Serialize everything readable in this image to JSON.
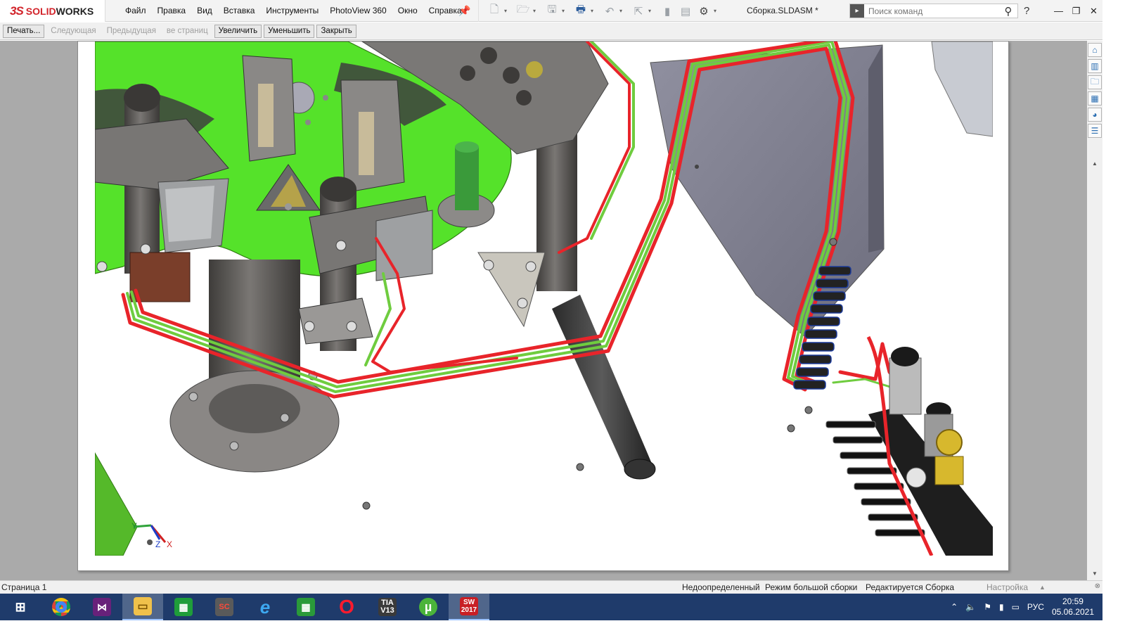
{
  "app": {
    "brand_ds": "3S",
    "brand_name_1": "SOLID",
    "brand_name_2": "WORKS",
    "document_title": "Сборка.SLDASM *"
  },
  "menu": {
    "items": [
      "Файл",
      "Правка",
      "Вид",
      "Вставка",
      "Инструменты",
      "PhotoView 360",
      "Окно",
      "Справка"
    ]
  },
  "quick_access_icons": [
    "new-icon",
    "open-icon",
    "save-icon",
    "print-icon",
    "undo-icon",
    "select-icon",
    "rebuild-icon",
    "file-properties-icon",
    "options-icon"
  ],
  "search": {
    "placeholder": "Поиск команд"
  },
  "window_controls": {
    "help": "?",
    "minimize": "—",
    "restore": "❐",
    "close": "✕"
  },
  "preview_toolbar": {
    "print": "Печать...",
    "next": "Следующая",
    "previous": "Предыдущая",
    "all_pages": "ве страниц",
    "zoom_in": "Увеличить",
    "zoom_out": "Уменьшить",
    "close": "Закрыть"
  },
  "status_bar": {
    "page": "Страница 1",
    "underdefined": "Недоопределенный",
    "large_assembly": "Режим большой сборки",
    "editing": "Редактируется Сборка",
    "customize": "Настройка"
  },
  "triad": {
    "x": "X",
    "y": "Y",
    "z": "Z"
  },
  "taskbar": {
    "apps": [
      {
        "name": "start",
        "label": ""
      },
      {
        "name": "chrome",
        "label": ""
      },
      {
        "name": "visual-studio",
        "label": ""
      },
      {
        "name": "file-explorer",
        "label": ""
      },
      {
        "name": "calculator",
        "label": ""
      },
      {
        "name": "sc-app",
        "label": "SC"
      },
      {
        "name": "internet-explorer",
        "label": "e"
      },
      {
        "name": "store",
        "label": ""
      },
      {
        "name": "opera",
        "label": "O"
      },
      {
        "name": "tia-portal",
        "label": "TIA\nV13"
      },
      {
        "name": "utorrent",
        "label": "µ"
      },
      {
        "name": "solidworks-2017",
        "label": "SW\n2017"
      }
    ],
    "language": "РУС",
    "time": "20:59",
    "date": "05.06.2021"
  },
  "colors": {
    "green_plate": "#55e22a",
    "pipe_red": "#e8242a",
    "pipe_green": "#6fcc3f",
    "metal_dark": "#5e5c5a",
    "taskbar": "#1f3b6b"
  }
}
